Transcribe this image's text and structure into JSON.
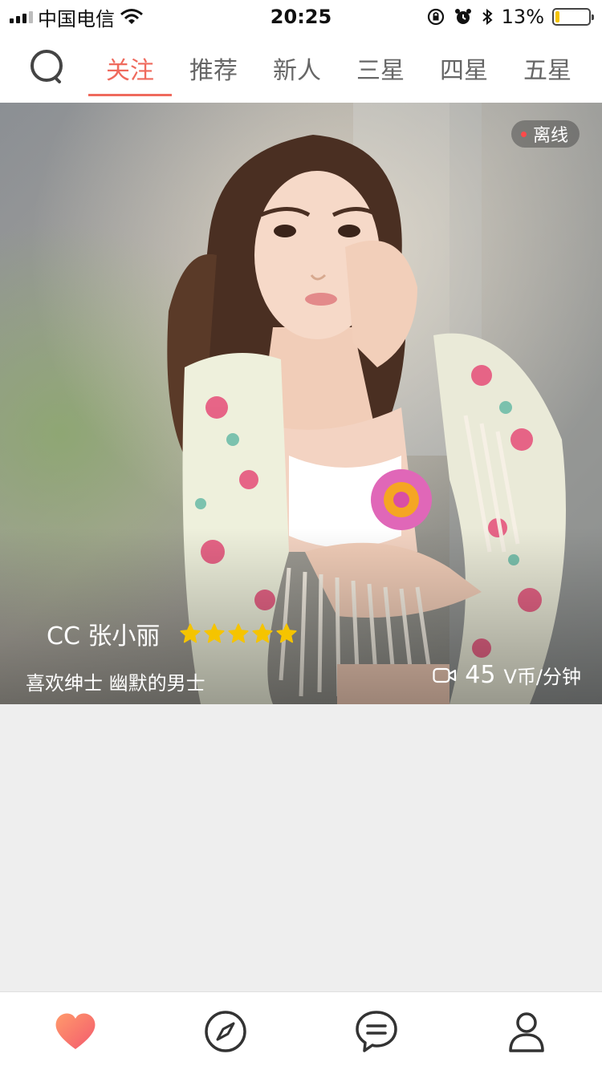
{
  "status_bar": {
    "carrier": "中国电信",
    "time": "20:25",
    "battery_percent": "13%",
    "battery_level": 0.13,
    "icons": [
      "signal-icon",
      "wifi-icon",
      "rotation-lock-icon",
      "alarm-icon",
      "bluetooth-icon",
      "battery-icon"
    ]
  },
  "tabs": [
    {
      "label": "关注",
      "active": true
    },
    {
      "label": "推荐",
      "active": false
    },
    {
      "label": "新人",
      "active": false
    },
    {
      "label": "三星",
      "active": false
    },
    {
      "label": "四星",
      "active": false
    },
    {
      "label": "五星",
      "active": false
    }
  ],
  "card": {
    "status": "离线",
    "name": "CC 张小丽",
    "rating": 5,
    "tagline": "喜欢绅士 幽默的男士",
    "price": "45",
    "price_unit": "V币/分钟"
  },
  "bottom_nav": [
    "heart-icon",
    "compass-icon",
    "chat-icon",
    "profile-icon"
  ],
  "colors": {
    "accent": "#ef6a5d",
    "star": "#f5c400",
    "empty_bg": "#eeeeee"
  }
}
